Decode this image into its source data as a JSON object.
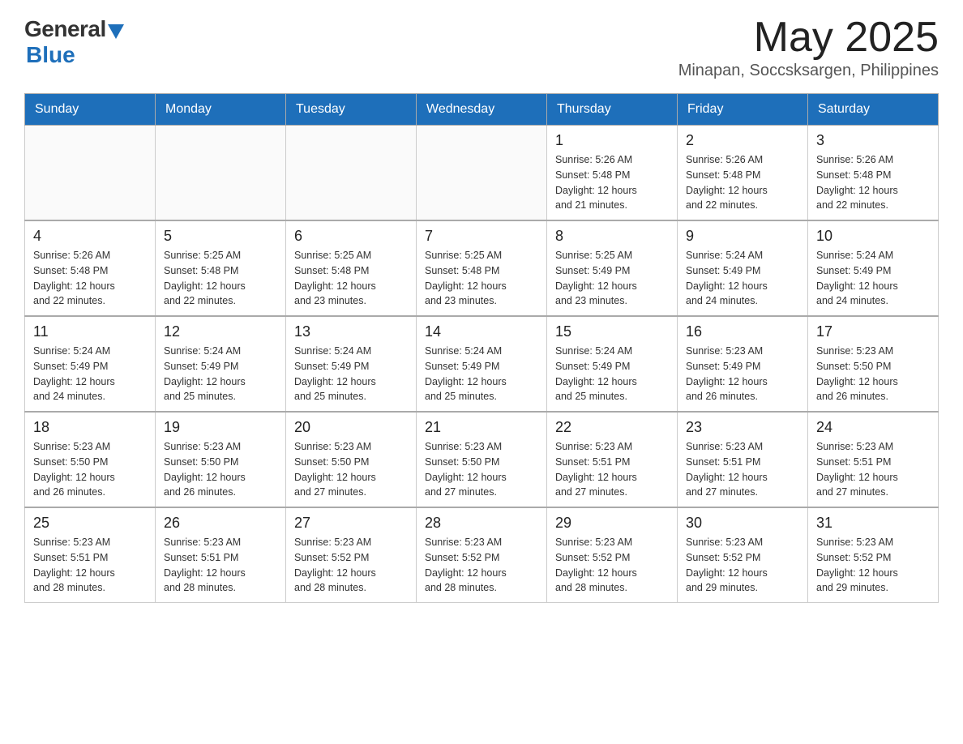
{
  "header": {
    "logo_general": "General",
    "logo_blue": "Blue",
    "month_title": "May 2025",
    "location": "Minapan, Soccsksargen, Philippines"
  },
  "days_of_week": [
    "Sunday",
    "Monday",
    "Tuesday",
    "Wednesday",
    "Thursday",
    "Friday",
    "Saturday"
  ],
  "weeks": [
    [
      {
        "day": "",
        "info": ""
      },
      {
        "day": "",
        "info": ""
      },
      {
        "day": "",
        "info": ""
      },
      {
        "day": "",
        "info": ""
      },
      {
        "day": "1",
        "info": "Sunrise: 5:26 AM\nSunset: 5:48 PM\nDaylight: 12 hours\nand 21 minutes."
      },
      {
        "day": "2",
        "info": "Sunrise: 5:26 AM\nSunset: 5:48 PM\nDaylight: 12 hours\nand 22 minutes."
      },
      {
        "day": "3",
        "info": "Sunrise: 5:26 AM\nSunset: 5:48 PM\nDaylight: 12 hours\nand 22 minutes."
      }
    ],
    [
      {
        "day": "4",
        "info": "Sunrise: 5:26 AM\nSunset: 5:48 PM\nDaylight: 12 hours\nand 22 minutes."
      },
      {
        "day": "5",
        "info": "Sunrise: 5:25 AM\nSunset: 5:48 PM\nDaylight: 12 hours\nand 22 minutes."
      },
      {
        "day": "6",
        "info": "Sunrise: 5:25 AM\nSunset: 5:48 PM\nDaylight: 12 hours\nand 23 minutes."
      },
      {
        "day": "7",
        "info": "Sunrise: 5:25 AM\nSunset: 5:48 PM\nDaylight: 12 hours\nand 23 minutes."
      },
      {
        "day": "8",
        "info": "Sunrise: 5:25 AM\nSunset: 5:49 PM\nDaylight: 12 hours\nand 23 minutes."
      },
      {
        "day": "9",
        "info": "Sunrise: 5:24 AM\nSunset: 5:49 PM\nDaylight: 12 hours\nand 24 minutes."
      },
      {
        "day": "10",
        "info": "Sunrise: 5:24 AM\nSunset: 5:49 PM\nDaylight: 12 hours\nand 24 minutes."
      }
    ],
    [
      {
        "day": "11",
        "info": "Sunrise: 5:24 AM\nSunset: 5:49 PM\nDaylight: 12 hours\nand 24 minutes."
      },
      {
        "day": "12",
        "info": "Sunrise: 5:24 AM\nSunset: 5:49 PM\nDaylight: 12 hours\nand 25 minutes."
      },
      {
        "day": "13",
        "info": "Sunrise: 5:24 AM\nSunset: 5:49 PM\nDaylight: 12 hours\nand 25 minutes."
      },
      {
        "day": "14",
        "info": "Sunrise: 5:24 AM\nSunset: 5:49 PM\nDaylight: 12 hours\nand 25 minutes."
      },
      {
        "day": "15",
        "info": "Sunrise: 5:24 AM\nSunset: 5:49 PM\nDaylight: 12 hours\nand 25 minutes."
      },
      {
        "day": "16",
        "info": "Sunrise: 5:23 AM\nSunset: 5:49 PM\nDaylight: 12 hours\nand 26 minutes."
      },
      {
        "day": "17",
        "info": "Sunrise: 5:23 AM\nSunset: 5:50 PM\nDaylight: 12 hours\nand 26 minutes."
      }
    ],
    [
      {
        "day": "18",
        "info": "Sunrise: 5:23 AM\nSunset: 5:50 PM\nDaylight: 12 hours\nand 26 minutes."
      },
      {
        "day": "19",
        "info": "Sunrise: 5:23 AM\nSunset: 5:50 PM\nDaylight: 12 hours\nand 26 minutes."
      },
      {
        "day": "20",
        "info": "Sunrise: 5:23 AM\nSunset: 5:50 PM\nDaylight: 12 hours\nand 27 minutes."
      },
      {
        "day": "21",
        "info": "Sunrise: 5:23 AM\nSunset: 5:50 PM\nDaylight: 12 hours\nand 27 minutes."
      },
      {
        "day": "22",
        "info": "Sunrise: 5:23 AM\nSunset: 5:51 PM\nDaylight: 12 hours\nand 27 minutes."
      },
      {
        "day": "23",
        "info": "Sunrise: 5:23 AM\nSunset: 5:51 PM\nDaylight: 12 hours\nand 27 minutes."
      },
      {
        "day": "24",
        "info": "Sunrise: 5:23 AM\nSunset: 5:51 PM\nDaylight: 12 hours\nand 27 minutes."
      }
    ],
    [
      {
        "day": "25",
        "info": "Sunrise: 5:23 AM\nSunset: 5:51 PM\nDaylight: 12 hours\nand 28 minutes."
      },
      {
        "day": "26",
        "info": "Sunrise: 5:23 AM\nSunset: 5:51 PM\nDaylight: 12 hours\nand 28 minutes."
      },
      {
        "day": "27",
        "info": "Sunrise: 5:23 AM\nSunset: 5:52 PM\nDaylight: 12 hours\nand 28 minutes."
      },
      {
        "day": "28",
        "info": "Sunrise: 5:23 AM\nSunset: 5:52 PM\nDaylight: 12 hours\nand 28 minutes."
      },
      {
        "day": "29",
        "info": "Sunrise: 5:23 AM\nSunset: 5:52 PM\nDaylight: 12 hours\nand 28 minutes."
      },
      {
        "day": "30",
        "info": "Sunrise: 5:23 AM\nSunset: 5:52 PM\nDaylight: 12 hours\nand 29 minutes."
      },
      {
        "day": "31",
        "info": "Sunrise: 5:23 AM\nSunset: 5:52 PM\nDaylight: 12 hours\nand 29 minutes."
      }
    ]
  ]
}
